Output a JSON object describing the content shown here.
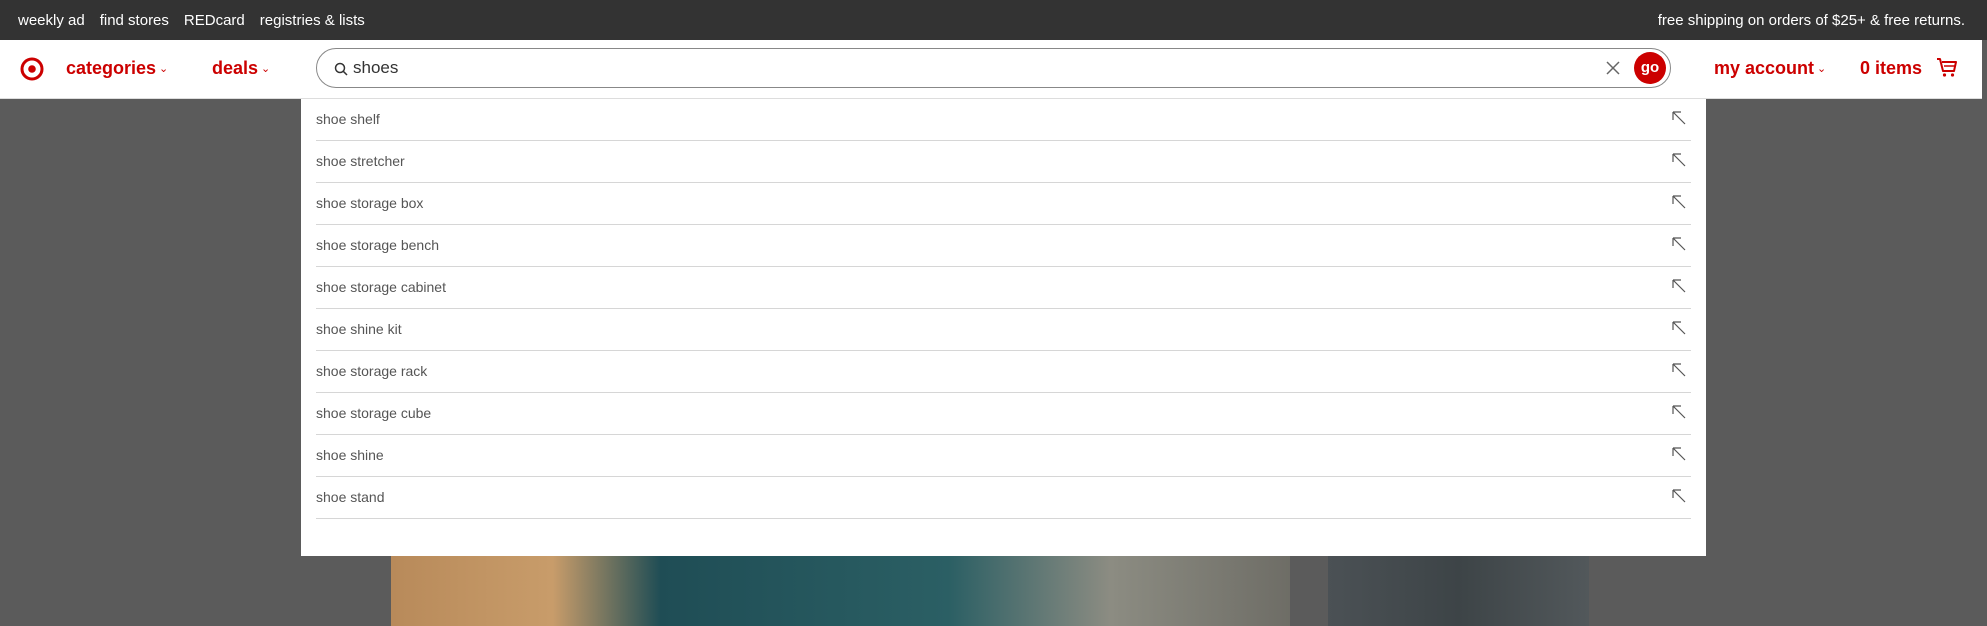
{
  "topbar": {
    "links": [
      "weekly ad",
      "find stores",
      "REDcard",
      "registries & lists"
    ],
    "promo": "free shipping on orders of $25+ & free returns."
  },
  "header": {
    "logo": "target-bullseye-icon",
    "categories_label": "categories",
    "deals_label": "deals",
    "account_label": "my account",
    "cart_label": "0 items",
    "brand_color": "#cc0000"
  },
  "search": {
    "value": "shoes",
    "go_label": "go"
  },
  "suggestions": [
    "shoe shelf",
    "shoe stretcher",
    "shoe storage box",
    "shoe storage bench",
    "shoe storage cabinet",
    "shoe shine kit",
    "shoe storage rack",
    "shoe storage cube",
    "shoe shine",
    "shoe stand"
  ]
}
